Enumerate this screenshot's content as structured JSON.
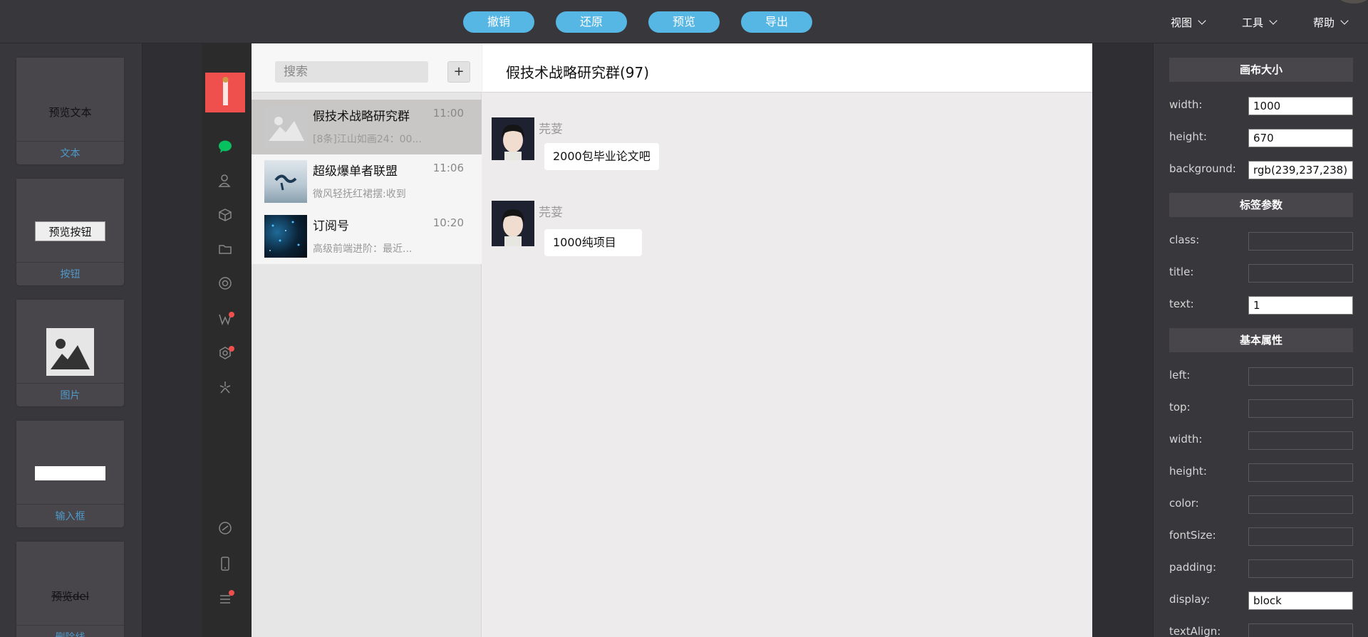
{
  "toolbar": {
    "undo": "撤销",
    "restore": "还原",
    "preview": "预览",
    "export": "导出",
    "menus": [
      "视图",
      "工具",
      "帮助"
    ]
  },
  "components": [
    {
      "preview": "预览文本",
      "label": "文本"
    },
    {
      "preview": "预览按钮",
      "label": "按钮"
    },
    {
      "preview": "",
      "label": "图片"
    },
    {
      "preview": "",
      "label": "输入框"
    },
    {
      "preview": "预览del",
      "label": "删除线"
    }
  ],
  "chat": {
    "search_placeholder": "搜索",
    "add": "+",
    "conversations": [
      {
        "name": "假技术战略研究群",
        "time": "11:00",
        "preview": "[8条]江山如画24：00..."
      },
      {
        "name": "超级爆单者联盟",
        "time": "11:06",
        "preview": "微风轻抚红裙摆:收到"
      },
      {
        "name": "订阅号",
        "time": "10:20",
        "preview": "高级前端进阶：最近..."
      }
    ],
    "window_title": "假技术战略研究群(97)",
    "messages": [
      {
        "sender": "芫荽",
        "text": "2000包毕业论文吧"
      },
      {
        "sender": "芫荽",
        "text": "1000纯项目"
      }
    ]
  },
  "props": {
    "canvas_head": "画布大小",
    "canvas": [
      {
        "label": "width:",
        "value": "1000"
      },
      {
        "label": "height:",
        "value": "670"
      },
      {
        "label": "background:",
        "value": "rgb(239,237,238)"
      }
    ],
    "tag_head": "标签参数",
    "tag": [
      {
        "label": "class:",
        "value": ""
      },
      {
        "label": "title:",
        "value": ""
      },
      {
        "label": "text:",
        "value": "1"
      }
    ],
    "basic_head": "基本属性",
    "basic": [
      {
        "label": "left:",
        "value": ""
      },
      {
        "label": "top:",
        "value": ""
      },
      {
        "label": "width:",
        "value": ""
      },
      {
        "label": "height:",
        "value": ""
      },
      {
        "label": "color:",
        "value": ""
      },
      {
        "label": "fontSize:",
        "value": ""
      },
      {
        "label": "padding:",
        "value": ""
      },
      {
        "label": "display:",
        "value": "block"
      },
      {
        "label": "textAlign:",
        "value": ""
      }
    ]
  },
  "colors": {
    "accent": "#56b6e4",
    "link": "#4f99c9",
    "wechat_red": "#f0504d",
    "wechat_green": "#07c160"
  }
}
